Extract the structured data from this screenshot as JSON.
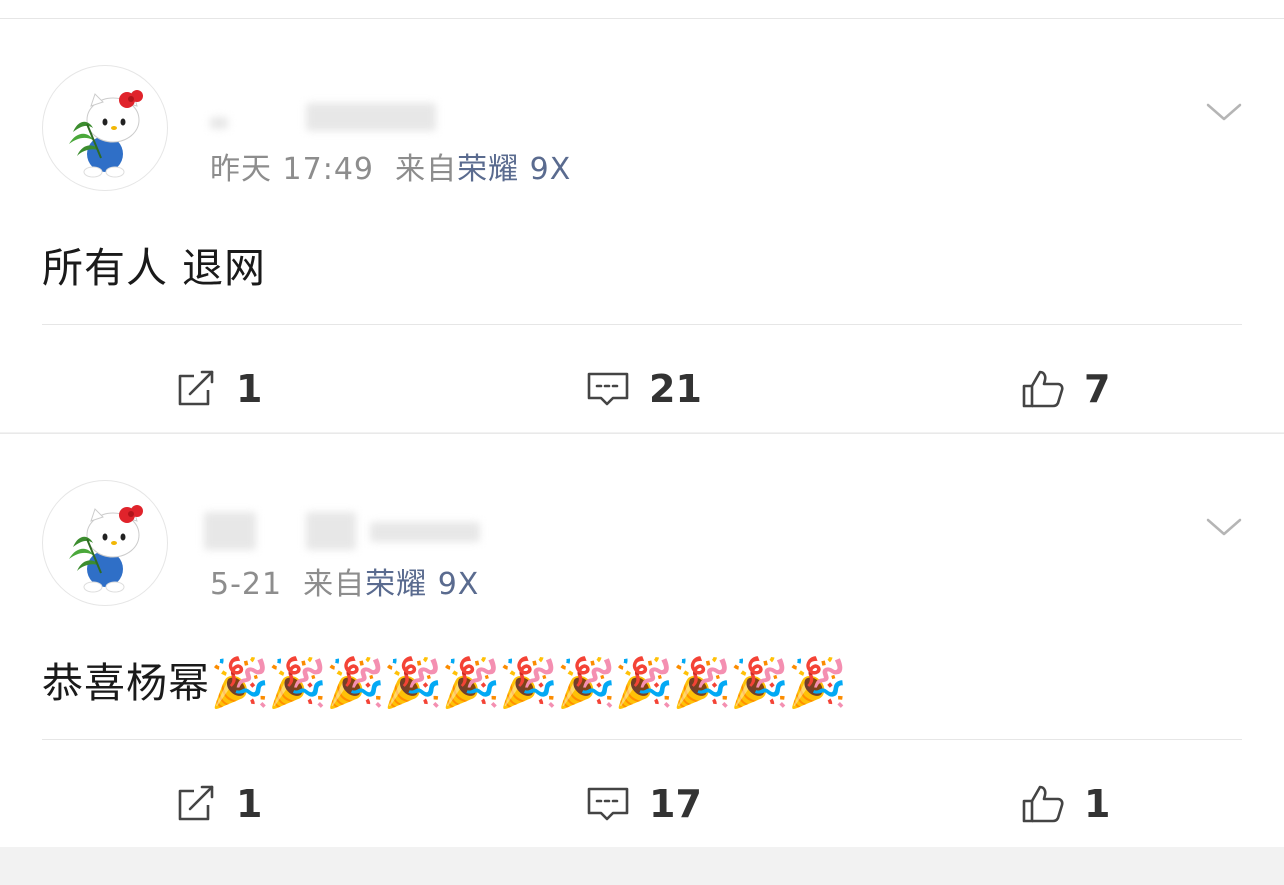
{
  "posts": [
    {
      "time": "昨天 17:49",
      "source_prefix": "来自",
      "source": "荣耀 9X",
      "text": "所有人 退网",
      "emoji": "",
      "reposts": "1",
      "comments": "21",
      "likes": "7"
    },
    {
      "time": "5-21",
      "source_prefix": "来自",
      "source": "荣耀 9X",
      "text": "恭喜杨幂",
      "emoji": "🎉🎉🎉🎉🎉🎉🎉🎉🎉🎉🎉",
      "reposts": "1",
      "comments": "17",
      "likes": "1"
    }
  ],
  "icons": {
    "avatar": "hello-kitty-avatar",
    "menu": "chevron-down-icon",
    "repost": "repost-icon",
    "comment": "comment-icon",
    "like": "thumbs-up-icon"
  },
  "colors": {
    "source_link": "#5a6b8f",
    "meta_text": "#8d8d8d",
    "body_text": "#1a1a1a"
  }
}
